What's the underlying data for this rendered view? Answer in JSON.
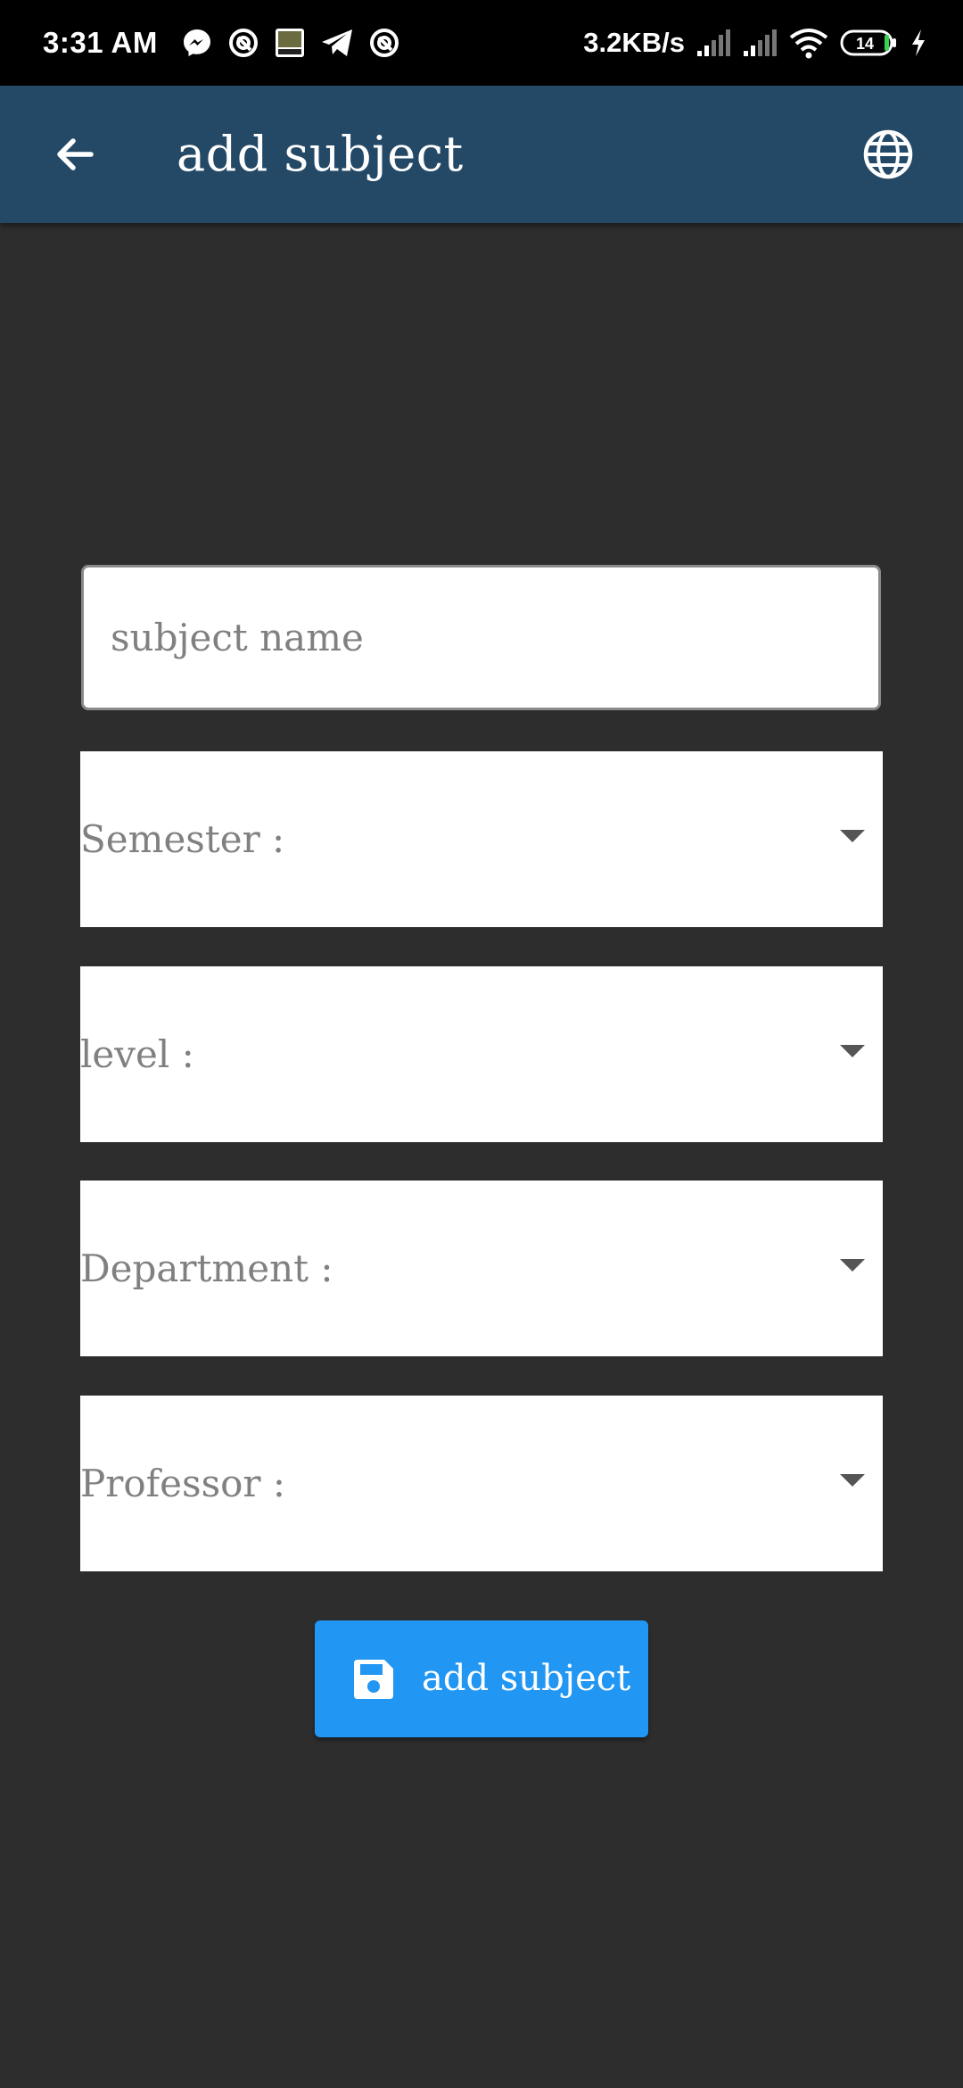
{
  "status_bar": {
    "time": "3:31 AM",
    "net_speed": "3.2KB/s",
    "battery": "14",
    "left_icons": [
      "messenger-icon",
      "notification-icon",
      "game-icon",
      "telegram-icon",
      "notification-icon"
    ],
    "right_icons": [
      "signal-icon",
      "signal-icon",
      "wifi-icon",
      "battery-icon",
      "charging-icon"
    ]
  },
  "app_bar": {
    "title": "add subject",
    "back_icon": "arrow-back-icon",
    "action_icon": "globe-icon",
    "background": "#244966"
  },
  "form": {
    "subject_name_placeholder": "subject name",
    "dropdowns": [
      {
        "label": "Semester :"
      },
      {
        "label": "level :"
      },
      {
        "label": "Department :"
      },
      {
        "label": "Professor :"
      }
    ],
    "submit": {
      "label": "add subject",
      "icon": "save-icon",
      "color": "#2196f3"
    }
  },
  "colors": {
    "background": "#2d2d2d",
    "status_bar": "#000000",
    "field_background": "#ffffff",
    "hint_text": "#808080"
  }
}
